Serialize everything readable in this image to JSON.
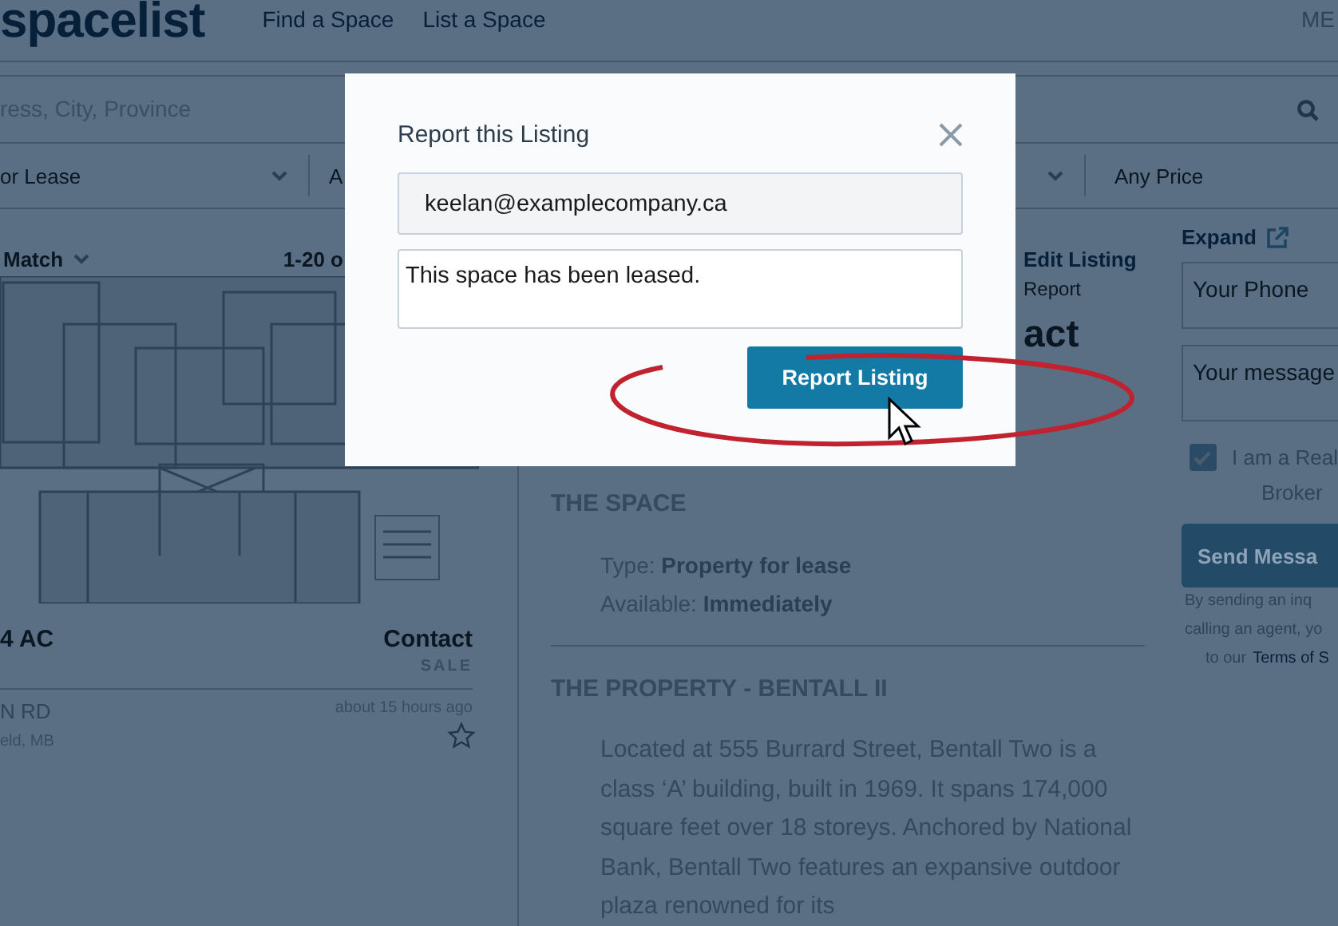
{
  "header": {
    "logo": "spacelist",
    "nav": [
      {
        "label": "Find a Space"
      },
      {
        "label": "List a Space"
      }
    ],
    "account": "ME"
  },
  "search": {
    "placeholder": "ress, City, Province"
  },
  "filters": [
    {
      "label": "or Lease",
      "dropdown": true
    },
    {
      "label": "A",
      "dropdown": true
    },
    {
      "label": "Any Price",
      "dropdown": false
    }
  ],
  "results": {
    "sort": "Match",
    "count": "1-20 o"
  },
  "listing": {
    "title": "4 AC",
    "price": "Contact",
    "deal": "SALE",
    "address": "N RD",
    "city": "eld, MB",
    "time": "about 15 hours ago",
    "favorite": false
  },
  "detail": {
    "edit": "Edit Listing",
    "report": "Report",
    "price": "act",
    "sections": [
      {
        "kind": "facts",
        "heading": "THE SPACE",
        "lines": [
          "Type: **Property for lease**",
          "Available: **Immediately**"
        ]
      },
      {
        "kind": "text",
        "heading": "THE PROPERTY - BENTALL II",
        "text": "Located at 555 Burrard Street, Bentall Two is a class ‘A’ building, built in 1969. It spans 174,000 square feet over 18 storeys. Anchored by National Bank, Bentall Two features an expansive outdoor plaza renowned for its"
      }
    ]
  },
  "contact": {
    "expand": "Expand",
    "phone_placeholder": "Your Phone",
    "message_placeholder": "Your message",
    "broker": {
      "checked": true,
      "lines": [
        "I am a Real",
        "Broker"
      ]
    },
    "send": "Send Messa",
    "disclaimer": [
      "By sending an inq",
      "calling an agent, yo"
    ],
    "disclaimer_end": "to our",
    "terms_link": "Terms of S"
  },
  "modal": {
    "title": "Report this Listing",
    "email": "keelan@examplecompany.ca",
    "message": "This space has been leased.",
    "submit": "Report Listing"
  }
}
